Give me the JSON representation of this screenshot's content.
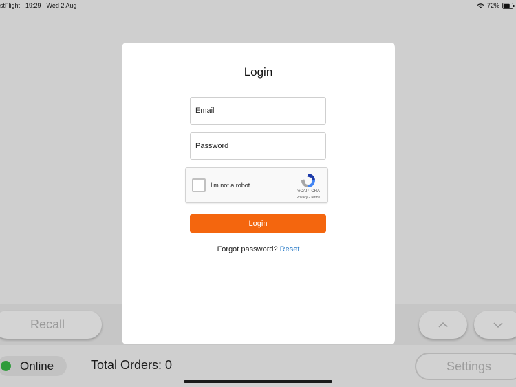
{
  "status_bar": {
    "app_name": "stFlight",
    "time": "19:29",
    "date": "Wed 2 Aug",
    "battery": "72%"
  },
  "background": {
    "recall_label": "Recall",
    "online_label": "Online",
    "online_color": "#2e9b3a",
    "total_orders_label": "Total Orders: 0",
    "settings_label": "Settings",
    "up_icon": "chevron-up-icon",
    "down_icon": "chevron-down-icon"
  },
  "login_modal": {
    "title": "Login",
    "email_placeholder": "Email",
    "password_placeholder": "Password",
    "recaptcha": {
      "label": "I'm not a robot",
      "brand": "reCAPTCHA",
      "links": "Privacy - Terms"
    },
    "login_button_label": "Login",
    "login_button_color": "#f4660e",
    "forgot_text": "Forgot password?",
    "reset_link_label": "Reset",
    "link_color": "#2a7bc7"
  }
}
